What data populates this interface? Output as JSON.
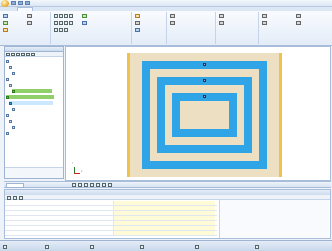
{
  "window": {
    "title": ""
  },
  "ribbon": {
    "tabs": [
      {
        "label": ""
      },
      {
        "label": ""
      },
      {
        "label": ""
      }
    ],
    "groups": [
      {
        "label": ""
      },
      {
        "label": ""
      },
      {
        "label": ""
      },
      {
        "label": ""
      },
      {
        "label": ""
      },
      {
        "label": ""
      }
    ],
    "buttons": [
      {
        "label": "",
        "icon": "draw-icon"
      },
      {
        "label": "",
        "icon": "edit-icon"
      },
      {
        "label": "",
        "icon": "box-icon"
      },
      {
        "label": "",
        "icon": "port-icon"
      },
      {
        "label": "",
        "icon": "mesh-icon"
      },
      {
        "label": "",
        "icon": "solve-icon"
      },
      {
        "label": "",
        "icon": "field-icon"
      },
      {
        "label": "",
        "icon": "report-icon"
      },
      {
        "label": "",
        "icon": "layer-icon"
      },
      {
        "label": "",
        "icon": "netlist-icon"
      }
    ]
  },
  "left_panel": {
    "title": "",
    "tree": [
      {
        "label": "",
        "style": "plain"
      },
      {
        "label": "",
        "style": "plain"
      },
      {
        "label": "",
        "style": "plain"
      },
      {
        "label": "",
        "style": "plain"
      },
      {
        "label": "",
        "style": "plain"
      },
      {
        "label": "",
        "style": "hl"
      },
      {
        "label": "",
        "style": "hl"
      },
      {
        "label": "",
        "style": "hl2"
      },
      {
        "label": "",
        "style": "plain"
      },
      {
        "label": "",
        "style": "plain"
      },
      {
        "label": "",
        "style": "plain"
      },
      {
        "label": "",
        "style": "plain"
      },
      {
        "label": "",
        "style": "plain"
      }
    ]
  },
  "viewport": {
    "design_colors": {
      "coil": "#2fa4e7",
      "substrate": "#ede0c2",
      "edge": "#f0c24a"
    },
    "axis": {
      "x_label": "X",
      "y_label": "Y"
    },
    "ruler_text": ""
  },
  "bottom_tabs": [
    {
      "label": ""
    },
    {
      "label": ""
    },
    {
      "label": ""
    }
  ],
  "properties": {
    "title": "",
    "rows": [
      {
        "key": "",
        "value": ""
      },
      {
        "key": "",
        "value": ""
      },
      {
        "key": "",
        "value": ""
      },
      {
        "key": "",
        "value": ""
      },
      {
        "key": "",
        "value": ""
      },
      {
        "key": "",
        "value": ""
      },
      {
        "key": "",
        "value": ""
      }
    ]
  },
  "status_bar": {
    "items": [
      {
        "label": ""
      },
      {
        "label": ""
      },
      {
        "label": ""
      },
      {
        "label": ""
      },
      {
        "label": ""
      },
      {
        "label": ""
      }
    ]
  },
  "colors": {
    "accent": "#2fa4e7",
    "highlight_green": "#8fd06a",
    "highlight_blue": "#cbe8ff"
  }
}
